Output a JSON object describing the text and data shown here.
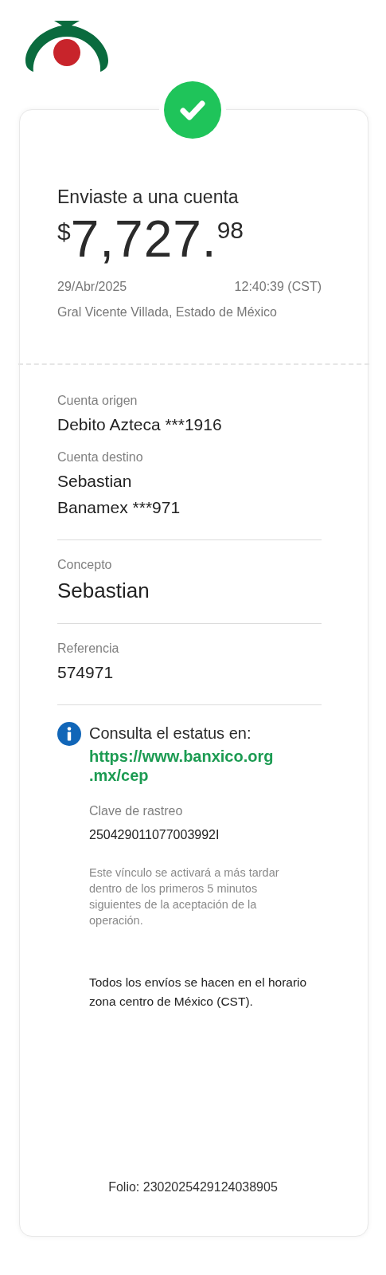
{
  "header": {
    "title": "Enviaste a una cuenta",
    "amount": {
      "currency": "$",
      "integer": "7,727.",
      "decimals": "98"
    },
    "date": "29/Abr/2025",
    "time": "12:40:39 (CST)",
    "location": "Gral Vicente Villada, Estado de México"
  },
  "sections": [
    {
      "fields": [
        {
          "label": "Cuenta origen",
          "kind": "normal",
          "lines": [
            "Debito Azteca ***1916"
          ]
        },
        {
          "label": "Cuenta destino",
          "kind": "normal",
          "lines": [
            "Sebastian",
            "Banamex ***971"
          ]
        }
      ]
    },
    {
      "fields": [
        {
          "label": "Concepto",
          "kind": "large",
          "lines": [
            "Sebastian"
          ]
        }
      ]
    },
    {
      "fields": [
        {
          "label": "Referencia",
          "kind": "normal",
          "lines": [
            "574971"
          ]
        }
      ]
    }
  ],
  "status": {
    "heading": "Consulta el estatus en:",
    "link_lines": [
      "https://www.banxico.org",
      ".mx/cep"
    ],
    "tracking_label": "Clave de rastreo",
    "tracking_key": "250429011077003992I",
    "note": "Este vínculo se activará a más tardar dentro de los primeros 5 minutos siguientes de la aceptación de la operación."
  },
  "timezone_note": "Todos los envíos se hacen en el horario zona centro de México (CST).",
  "folio": "Folio: 2302025429124038905"
}
